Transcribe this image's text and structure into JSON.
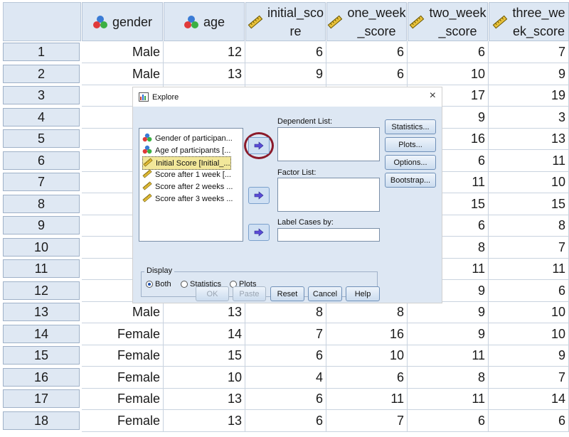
{
  "columns": [
    "gender",
    "age",
    "initial_score",
    "one_week_score",
    "two_week_score",
    "three_week_score"
  ],
  "column_header_display": [
    [
      "gender"
    ],
    [
      "age"
    ],
    [
      "initial_sco",
      "re"
    ],
    [
      "one_week",
      "_score"
    ],
    [
      "two_week",
      "_score"
    ],
    [
      "three_we",
      "ek_score"
    ]
  ],
  "column_types": [
    "nominal",
    "nominal",
    "scale",
    "scale",
    "scale",
    "scale"
  ],
  "rows": [
    {
      "n": "1",
      "cells": [
        "Male",
        "12",
        "6",
        "6",
        "6",
        "7"
      ]
    },
    {
      "n": "2",
      "cells": [
        "Male",
        "13",
        "9",
        "6",
        "10",
        "9"
      ]
    },
    {
      "n": "3",
      "cells": [
        "",
        "",
        "",
        "",
        "17",
        "19"
      ]
    },
    {
      "n": "4",
      "cells": [
        "",
        "",
        "",
        "",
        "9",
        "3"
      ]
    },
    {
      "n": "5",
      "cells": [
        "",
        "",
        "",
        "",
        "16",
        "13"
      ]
    },
    {
      "n": "6",
      "cells": [
        "",
        "",
        "",
        "",
        "6",
        "11"
      ]
    },
    {
      "n": "7",
      "cells": [
        "",
        "",
        "",
        "",
        "11",
        "10"
      ]
    },
    {
      "n": "8",
      "cells": [
        "",
        "",
        "",
        "",
        "15",
        "15"
      ]
    },
    {
      "n": "9",
      "cells": [
        "",
        "",
        "",
        "",
        "6",
        "8"
      ]
    },
    {
      "n": "10",
      "cells": [
        "",
        "",
        "",
        "",
        "8",
        "7"
      ]
    },
    {
      "n": "11",
      "cells": [
        "",
        "",
        "",
        "",
        "11",
        "11"
      ]
    },
    {
      "n": "12",
      "cells": [
        "",
        "",
        "",
        "",
        "9",
        "6"
      ]
    },
    {
      "n": "13",
      "cells": [
        "Male",
        "13",
        "8",
        "8",
        "9",
        "10"
      ]
    },
    {
      "n": "14",
      "cells": [
        "Female",
        "14",
        "7",
        "16",
        "9",
        "10"
      ]
    },
    {
      "n": "15",
      "cells": [
        "Female",
        "15",
        "6",
        "10",
        "11",
        "9"
      ]
    },
    {
      "n": "16",
      "cells": [
        "Female",
        "10",
        "4",
        "6",
        "8",
        "7"
      ]
    },
    {
      "n": "17",
      "cells": [
        "Female",
        "13",
        "6",
        "11",
        "11",
        "14"
      ]
    },
    {
      "n": "18",
      "cells": [
        "Female",
        "13",
        "6",
        "7",
        "6",
        "6"
      ]
    }
  ],
  "dialog": {
    "title": "Explore",
    "close_glyph": "×",
    "variables": [
      {
        "label": "Gender of participan...",
        "type": "nominal",
        "selected": false
      },
      {
        "label": "Age of participants [...",
        "type": "nominal",
        "selected": false
      },
      {
        "label": "Initial Score [Initial_...",
        "type": "scale",
        "selected": true
      },
      {
        "label": "Score after 1 week [...",
        "type": "scale",
        "selected": false
      },
      {
        "label": "Score after 2 weeks ...",
        "type": "scale",
        "selected": false
      },
      {
        "label": "Score after 3 weeks ...",
        "type": "scale",
        "selected": false
      }
    ],
    "dependent_list_label": "Dependent List:",
    "factor_list_label": "Factor List:",
    "label_cases_label": "Label Cases by:",
    "side_buttons": [
      "Statistics...",
      "Plots...",
      "Options...",
      "Bootstrap..."
    ],
    "display_label": "Display",
    "display_options": [
      {
        "label": "Both",
        "selected": true
      },
      {
        "label": "Statistics",
        "selected": false
      },
      {
        "label": "Plots",
        "selected": false
      }
    ],
    "bottom_buttons": [
      {
        "label": "OK",
        "enabled": false
      },
      {
        "label": "Paste",
        "enabled": false
      },
      {
        "label": "Reset",
        "enabled": true
      },
      {
        "label": "Cancel",
        "enabled": true
      },
      {
        "label": "Help",
        "enabled": true
      }
    ],
    "accent_color": "#8b1a2a"
  }
}
